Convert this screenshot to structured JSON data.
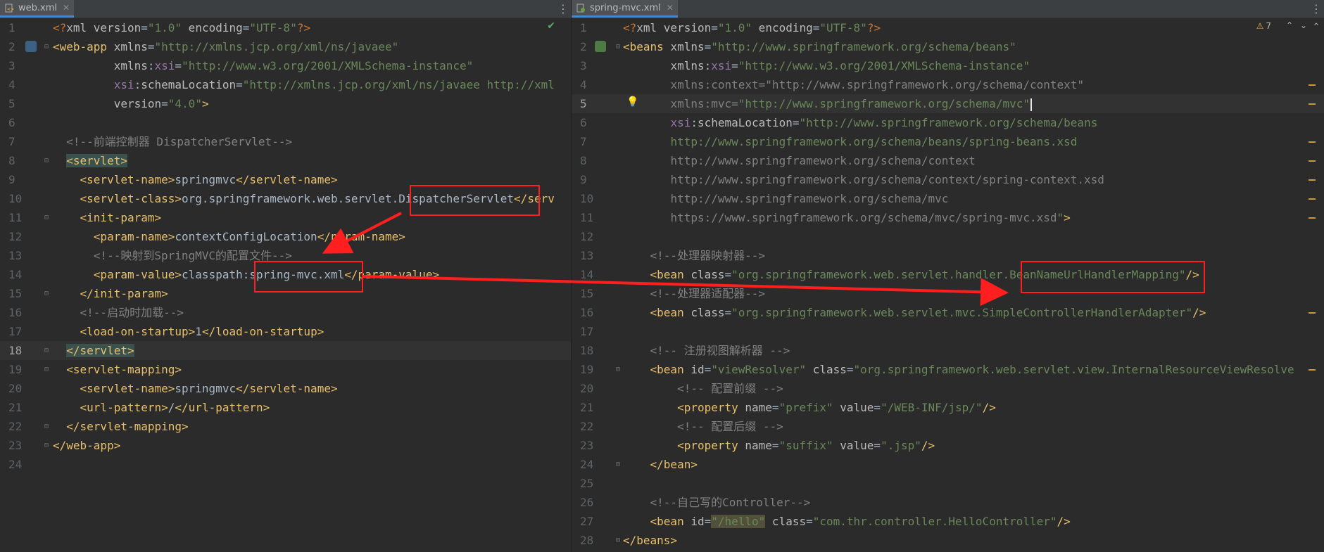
{
  "left_editor": {
    "tab_name": "web.xml",
    "file_icon": "xml-file-icon",
    "status_icon": "check-icon",
    "lines": [
      [
        [
          "pi",
          "<?"
        ],
        [
          "a",
          "xml "
        ],
        [
          "a",
          "version"
        ],
        [
          "p",
          "="
        ],
        [
          "v",
          "\"1.0\""
        ],
        [
          "a",
          " encoding"
        ],
        [
          "p",
          "="
        ],
        [
          "v",
          "\"UTF-8\""
        ],
        [
          "pi",
          "?>"
        ]
      ],
      [
        [
          "t",
          "<web-app "
        ],
        [
          "a",
          "xmlns"
        ],
        [
          "p",
          "="
        ],
        [
          "v",
          "\"http://xmlns.jcp.org/xml/ns/javaee\""
        ]
      ],
      [
        [
          "p",
          "         "
        ],
        [
          "a",
          "xmlns"
        ],
        [
          "p",
          ":"
        ],
        [
          "ns",
          "xsi"
        ],
        [
          "p",
          "="
        ],
        [
          "v",
          "\"http://www.w3.org/2001/XMLSchema-instance\""
        ]
      ],
      [
        [
          "p",
          "         "
        ],
        [
          "ns",
          "xsi"
        ],
        [
          "p",
          ":"
        ],
        [
          "a",
          "schemaLocation"
        ],
        [
          "p",
          "="
        ],
        [
          "v",
          "\"http://xmlns.jcp.org/xml/ns/javaee http://xml"
        ]
      ],
      [
        [
          "p",
          "         "
        ],
        [
          "a",
          "version"
        ],
        [
          "p",
          "="
        ],
        [
          "v",
          "\"4.0\""
        ],
        [
          "t",
          ">"
        ]
      ],
      [],
      [
        [
          "p",
          "  "
        ],
        [
          "c",
          "<!--前端控制器 DispatcherServlet-->"
        ]
      ],
      [
        [
          "p",
          "  "
        ],
        [
          "t",
          "<servlet>"
        ]
      ],
      [
        [
          "p",
          "    "
        ],
        [
          "t",
          "<servlet-name>"
        ],
        [
          "p",
          "springmvc"
        ],
        [
          "t",
          "</servlet-name>"
        ]
      ],
      [
        [
          "p",
          "    "
        ],
        [
          "t",
          "<servlet-class>"
        ],
        [
          "p",
          "org.springframework.web.servlet.DispatcherServlet"
        ],
        [
          "t",
          "</serv"
        ]
      ],
      [
        [
          "p",
          "    "
        ],
        [
          "t",
          "<init-param>"
        ]
      ],
      [
        [
          "p",
          "      "
        ],
        [
          "t",
          "<param-name>"
        ],
        [
          "p",
          "contextConfigLocation"
        ],
        [
          "t",
          "</param-name>"
        ]
      ],
      [
        [
          "p",
          "      "
        ],
        [
          "c",
          "<!--映射到SpringMVC的配置文件-->"
        ]
      ],
      [
        [
          "p",
          "      "
        ],
        [
          "t",
          "<param-value>"
        ],
        [
          "p",
          "classpath:spring-mvc.xml"
        ],
        [
          "t",
          "</param-value>"
        ]
      ],
      [
        [
          "p",
          "    "
        ],
        [
          "t",
          "</init-param>"
        ]
      ],
      [
        [
          "p",
          "    "
        ],
        [
          "c",
          "<!--启动时加载-->"
        ]
      ],
      [
        [
          "p",
          "    "
        ],
        [
          "t",
          "<load-on-startup>"
        ],
        [
          "p",
          "1"
        ],
        [
          "t",
          "</load-on-startup>"
        ]
      ],
      [
        [
          "p",
          "  "
        ],
        [
          "t",
          "</servlet>"
        ]
      ],
      [
        [
          "p",
          "  "
        ],
        [
          "t",
          "<servlet-mapping>"
        ]
      ],
      [
        [
          "p",
          "    "
        ],
        [
          "t",
          "<servlet-name>"
        ],
        [
          "p",
          "springmvc"
        ],
        [
          "t",
          "</servlet-name>"
        ]
      ],
      [
        [
          "p",
          "    "
        ],
        [
          "t",
          "<url-pattern>"
        ],
        [
          "p",
          "/"
        ],
        [
          "t",
          "</url-pattern>"
        ]
      ],
      [
        [
          "p",
          "  "
        ],
        [
          "t",
          "</servlet-mapping>"
        ]
      ],
      [
        [
          "t",
          "</web-app>"
        ]
      ],
      []
    ],
    "current_line": 18
  },
  "right_editor": {
    "tab_name": "spring-mvc.xml",
    "file_icon": "xml-file-icon",
    "warning_count": "7",
    "warning_icon": "warning-icon",
    "lines": [
      [
        [
          "pi",
          "<?"
        ],
        [
          "a",
          "xml "
        ],
        [
          "a",
          "version"
        ],
        [
          "p",
          "="
        ],
        [
          "v",
          "\"1.0\""
        ],
        [
          "a",
          " encoding"
        ],
        [
          "p",
          "="
        ],
        [
          "v",
          "\"UTF-8\""
        ],
        [
          "pi",
          "?>"
        ]
      ],
      [
        [
          "t",
          "<beans "
        ],
        [
          "a",
          "xmlns"
        ],
        [
          "p",
          "="
        ],
        [
          "v",
          "\"http://www.springframework.org/schema/beans\""
        ]
      ],
      [
        [
          "p",
          "       "
        ],
        [
          "a",
          "xmlns"
        ],
        [
          "p",
          ":"
        ],
        [
          "ns",
          "xsi"
        ],
        [
          "p",
          "="
        ],
        [
          "v",
          "\"http://www.w3.org/2001/XMLSchema-instance\""
        ]
      ],
      [
        [
          "p",
          "       "
        ],
        [
          "c",
          "xmlns:context=\"http://www.springframework.org/schema/context\""
        ]
      ],
      [
        [
          "p",
          "       "
        ],
        [
          "c",
          "xmlns:mvc="
        ],
        [
          "v",
          "\"http://www.springframework.org/schema/mvc\""
        ]
      ],
      [
        [
          "p",
          "       "
        ],
        [
          "ns",
          "xsi"
        ],
        [
          "p",
          ":"
        ],
        [
          "a",
          "schemaLocation"
        ],
        [
          "p",
          "="
        ],
        [
          "v",
          "\"http://www.springframework.org/schema/beans"
        ]
      ],
      [
        [
          "p",
          "       "
        ],
        [
          "v",
          "http://www.springframework.org/schema/beans/spring-beans.xsd"
        ]
      ],
      [
        [
          "p",
          "       "
        ],
        [
          "c",
          "http://www.springframework.org/schema/context"
        ]
      ],
      [
        [
          "p",
          "       "
        ],
        [
          "c",
          "http://www.springframework.org/schema/context/spring-context.xsd"
        ]
      ],
      [
        [
          "p",
          "       "
        ],
        [
          "c",
          "http://www.springframework.org/schema/mvc"
        ]
      ],
      [
        [
          "p",
          "       "
        ],
        [
          "c",
          "https://www.springframework.org/schema/mvc/spring-mvc.xsd"
        ],
        [
          "v",
          "\""
        ],
        [
          "t",
          ">"
        ]
      ],
      [],
      [
        [
          "p",
          "    "
        ],
        [
          "c",
          "<!--处理器映射器-->"
        ]
      ],
      [
        [
          "p",
          "    "
        ],
        [
          "t",
          "<bean "
        ],
        [
          "a",
          "class"
        ],
        [
          "p",
          "="
        ],
        [
          "v",
          "\"org.springframework.web.servlet.handler.BeanNameUrlHandlerMapping\""
        ],
        [
          "t",
          "/>"
        ]
      ],
      [
        [
          "p",
          "    "
        ],
        [
          "c",
          "<!--处理器适配器-->"
        ]
      ],
      [
        [
          "p",
          "    "
        ],
        [
          "t",
          "<bean "
        ],
        [
          "a",
          "class"
        ],
        [
          "p",
          "="
        ],
        [
          "v",
          "\"org.springframework.web.servlet.mvc.SimpleControllerHandlerAdapter\""
        ],
        [
          "t",
          "/>"
        ]
      ],
      [],
      [
        [
          "p",
          "    "
        ],
        [
          "c",
          "<!-- 注册视图解析器 -->"
        ]
      ],
      [
        [
          "p",
          "    "
        ],
        [
          "t",
          "<bean "
        ],
        [
          "a",
          "id"
        ],
        [
          "p",
          "="
        ],
        [
          "v",
          "\"viewResolver\""
        ],
        [
          "a",
          " class"
        ],
        [
          "p",
          "="
        ],
        [
          "v",
          "\"org.springframework.web.servlet.view.InternalResourceViewResolve"
        ]
      ],
      [
        [
          "p",
          "        "
        ],
        [
          "c",
          "<!-- 配置前缀 -->"
        ]
      ],
      [
        [
          "p",
          "        "
        ],
        [
          "t",
          "<property "
        ],
        [
          "a",
          "name"
        ],
        [
          "p",
          "="
        ],
        [
          "v",
          "\"prefix\""
        ],
        [
          "a",
          " value"
        ],
        [
          "p",
          "="
        ],
        [
          "v",
          "\"/WEB-INF/jsp/\""
        ],
        [
          "t",
          "/>"
        ]
      ],
      [
        [
          "p",
          "        "
        ],
        [
          "c",
          "<!-- 配置后缀 -->"
        ]
      ],
      [
        [
          "p",
          "        "
        ],
        [
          "t",
          "<property "
        ],
        [
          "a",
          "name"
        ],
        [
          "p",
          "="
        ],
        [
          "v",
          "\"suffix\""
        ],
        [
          "a",
          " value"
        ],
        [
          "p",
          "="
        ],
        [
          "v",
          "\".jsp\""
        ],
        [
          "t",
          "/>"
        ]
      ],
      [
        [
          "p",
          "    "
        ],
        [
          "t",
          "</bean>"
        ]
      ],
      [],
      [
        [
          "p",
          "    "
        ],
        [
          "c",
          "<!--自己写的Controller-->"
        ]
      ],
      [
        [
          "p",
          "    "
        ],
        [
          "t",
          "<bean "
        ],
        [
          "a",
          "id"
        ],
        [
          "p",
          "="
        ],
        [
          "v",
          "\"/hello\""
        ],
        [
          "a",
          " class"
        ],
        [
          "p",
          "="
        ],
        [
          "v",
          "\"com.thr.controller.HelloController\""
        ],
        [
          "t",
          "/>"
        ]
      ],
      [
        [
          "t",
          "</beans>"
        ]
      ]
    ],
    "current_line": 5
  },
  "colors": {
    "background": "#2b2b2b",
    "annotation_red": "#ff1f1f",
    "tag": "#e8bf6a",
    "string": "#6a8759",
    "comment": "#808080"
  }
}
